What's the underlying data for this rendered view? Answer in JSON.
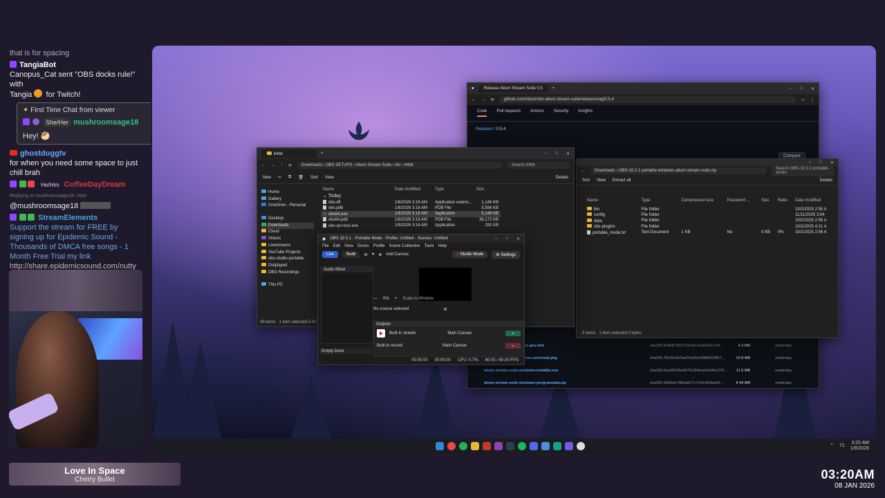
{
  "chat": {
    "spacer": "that is for spacing",
    "msg1": {
      "name": "TangiaBot",
      "text_a": "Canopus_Cat sent \"OBS docks rule!\" with",
      "text_b": "Tangia",
      "text_c": "for Twitch!"
    },
    "first_chat": {
      "header": "First Time Chat from viewer",
      "pronoun": "She/Her",
      "name": "mushroomsage18",
      "text": "Hey!"
    },
    "msg2": {
      "name": "ghostdoggtv",
      "text": "for when you need some space to just chill brah"
    },
    "msg3": {
      "pronoun": "He/Him",
      "name": "CoffeeDayDream",
      "reply": "Replying to mushroomsage18: Hey!",
      "text": "@mushroomsage18"
    },
    "msg4": {
      "name": "StreamElements",
      "text": "Support the stream for FREE by signing up for Epidemic Sound - Thousands of DMCA free songs - 1 Month Free Trial my link",
      "link": "http://share.epidemicsound.com/nutty"
    }
  },
  "now_playing": {
    "title": "Love In Space",
    "artist": "Cherry Bullet"
  },
  "clock": {
    "time": "03:20AM",
    "date": "08 JAN 2026"
  },
  "github": {
    "tab_title": "Release Aitum Stream Suite 0.5",
    "url": "github.com/Aitum/obs-aitum-stream-suite/releases/tag/0.5.4",
    "tabs": [
      "Code",
      "Pull requests",
      "Actions",
      "Security",
      "Insights"
    ],
    "crumb_root": "Releases",
    "crumb_sep": "/",
    "crumb_version": "0.5.4",
    "compare": "Compare",
    "assets": [
      {
        "name": "aitum-stream-suite-linux-gnu.deb",
        "hash": "sha256:0cf8d57561f7be4b131a6116c7e4...",
        "size": "5.4 MB",
        "date": "yesterday"
      },
      {
        "name": "aitum-stream-suite-macos-universal.pkg",
        "hash": "sha256:78c82a9e3ad7be80a189fb503857...",
        "size": "14.9 MB",
        "date": "yesterday"
      },
      {
        "name": "aitum-stream-suite-windows-installer.exe",
        "hash": "sha256:dea09149a4579c2b9eae9c68ec276...",
        "size": "11.9 MB",
        "date": "yesterday"
      },
      {
        "name": "aitum-stream-suite-windows-programdata.zip",
        "hash": "sha256:348deb7485a82717c00c464aed5...",
        "size": "8.44 MB",
        "date": "yesterday"
      }
    ]
  },
  "explorer1": {
    "tab_title": "64bit",
    "breadcrumb": [
      "Downloads",
      "OBS SETUPS",
      "Aitum Stream Suite",
      "bin",
      "64bit"
    ],
    "search_placeholder": "Search 64bit",
    "cmd": {
      "new": "New",
      "sort": "Sort",
      "view": "View",
      "details": "Details"
    },
    "nav": [
      "Home",
      "Gallery",
      "OneDrive - Personal",
      "Desktop",
      "Downloads",
      "Cloud",
      "Videos",
      "Livestreams",
      "YouTube Projects",
      "obs-studio-portable",
      "Outplayed",
      "OBS Recordings",
      "This PC"
    ],
    "columns": [
      "Name",
      "Date modified",
      "Type",
      "Size"
    ],
    "group": "Today",
    "files": [
      {
        "name": "obs.dll",
        "date": "1/8/2026 3:16 AM",
        "type": "Application extens...",
        "size": "1,146 KB"
      },
      {
        "name": "obs.pdb",
        "date": "1/8/2026 3:16 AM",
        "type": "PDB File",
        "size": "5,556 KB"
      },
      {
        "name": "obs64.exe",
        "date": "1/8/2026 3:16 AM",
        "type": "Application",
        "size": "5,148 KB"
      },
      {
        "name": "obs64.pdb",
        "date": "1/8/2026 3:16 AM",
        "type": "PDB File",
        "size": "39,172 KB"
      },
      {
        "name": "obs-qrv-test.exe",
        "date": "1/8/2026 3:16 AM",
        "type": "Application",
        "size": "292 KB"
      }
    ],
    "status": "49 items",
    "status_sel": "1 item selected 5.02 MB"
  },
  "explorer2": {
    "breadcrumb": [
      "Downloads",
      "OBS-32.0.1-portable-windows-aitum-stream-suite.zip"
    ],
    "search_placeholder": "Search OBS-32.0.1-portable-windo",
    "cmd": {
      "sort": "Sort",
      "view": "View",
      "extract": "Extract all",
      "details": "Details"
    },
    "columns": [
      "Name",
      "Type",
      "Compressed size",
      "Password ...",
      "Size",
      "Ratio",
      "Date modified"
    ],
    "files": [
      {
        "name": "bin",
        "type": "File folder",
        "csize": "",
        "pw": "",
        "size": "",
        "ratio": "",
        "date": "10/2/2025 2:55 A"
      },
      {
        "name": "config",
        "type": "File folder",
        "csize": "",
        "pw": "",
        "size": "",
        "ratio": "",
        "date": "11/11/2025 3:54"
      },
      {
        "name": "data",
        "type": "File folder",
        "csize": "",
        "pw": "",
        "size": "",
        "ratio": "",
        "date": "10/2/2025 2:55 A"
      },
      {
        "name": "obs-plugins",
        "type": "File folder",
        "csize": "",
        "pw": "",
        "size": "",
        "ratio": "",
        "date": "10/2/2025 4:21 A"
      },
      {
        "name": "portable_mode.txt",
        "type": "Text Document",
        "csize": "1 KB",
        "pw": "No",
        "size": "0 KB",
        "ratio": "0%",
        "date": "10/2/2025 2:56 A"
      }
    ],
    "status": "5 items",
    "status_sel": "1 item selected 0 bytes"
  },
  "obs": {
    "title": "OBS 32.0.1 - Portable Mode - Profile: Untitled - Scenes: Untitled",
    "menu": [
      "File",
      "Edit",
      "View",
      "Docks",
      "Profile",
      "Scene Collection",
      "Tools",
      "Help"
    ],
    "live": "Live",
    "build": "Build",
    "add_canvas": "Add Canvas",
    "studio_mode": "Studio Mode",
    "settings": "Settings",
    "audio_mixer": "Audio Mixer",
    "zoom": "0%",
    "scale": "Scale to Window",
    "no_source": "No source selected",
    "outputs_title": "Outputs",
    "outputs": [
      {
        "name": "Built-in stream",
        "canvas": "Main Canvas"
      },
      {
        "name": "Built-in record",
        "canvas": "Main Canvas"
      }
    ],
    "empty_dock": "Empty Dock",
    "status": {
      "time1": "00:00:00",
      "time2": "00:00:00",
      "cpu": "CPU: 0.7%",
      "fps": "60.00 / 60.00 FPS"
    }
  },
  "taskbar": {
    "battery": "71",
    "time": "3:20 AM",
    "date": "1/8/2026"
  }
}
